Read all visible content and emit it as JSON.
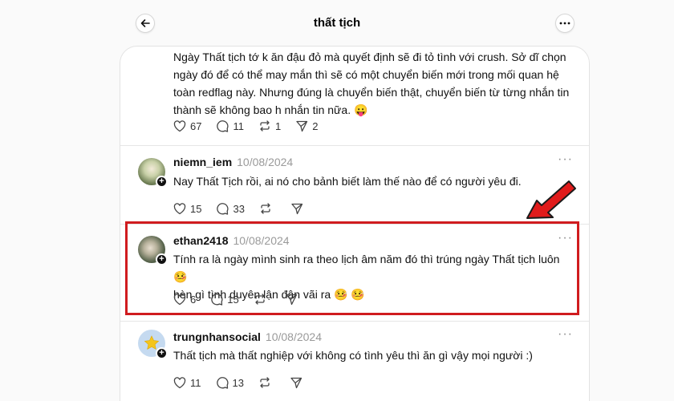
{
  "header": {
    "title": "thất tịch"
  },
  "posts": [
    {
      "text": "Ngày Thất tịch tớ k ăn đậu đỏ mà quyết định sẽ đi tỏ tình với crush. Sở dĩ chọn ngày đó để có thể may mắn thì sẽ có một chuyển biến mới trong mối quan hệ toàn redflag này. Nhưng đúng là chuyển biến thật, chuyển biến từ từng nhắn tin thành sẽ không bao h nhắn tin nữa. 😛",
      "likes": "67",
      "comments": "11",
      "reposts": "1",
      "shares": "2"
    },
    {
      "username": "niemn_iem",
      "date": "10/08/2024",
      "text": "Nay Thất Tịch rồi, ai nó cho bảnh biết làm thế nào để có người yêu đi.",
      "likes": "15",
      "comments": "33",
      "reposts": "",
      "shares": ""
    },
    {
      "username": "ethan2418",
      "date": "10/08/2024",
      "text_line1": "Tính ra là ngày mình sinh ra theo lịch âm năm đó thì trúng ngày Thất tịch luôn 🤒",
      "text_line2": "hèn gì tình duyên lận đận vãi ra 🤒 🤒",
      "likes": "6",
      "comments": "15",
      "reposts": "",
      "shares": ""
    },
    {
      "username": "trungnhansocial",
      "date": "10/08/2024",
      "text": "Thất tịch mà thất nghiệp với không có tình yêu thì ăn gì vậy mọi người :)",
      "likes": "11",
      "comments": "13",
      "reposts": "",
      "shares": ""
    }
  ],
  "colors": {
    "highlight": "#d01c1f",
    "arrow": "#e01b1b"
  }
}
